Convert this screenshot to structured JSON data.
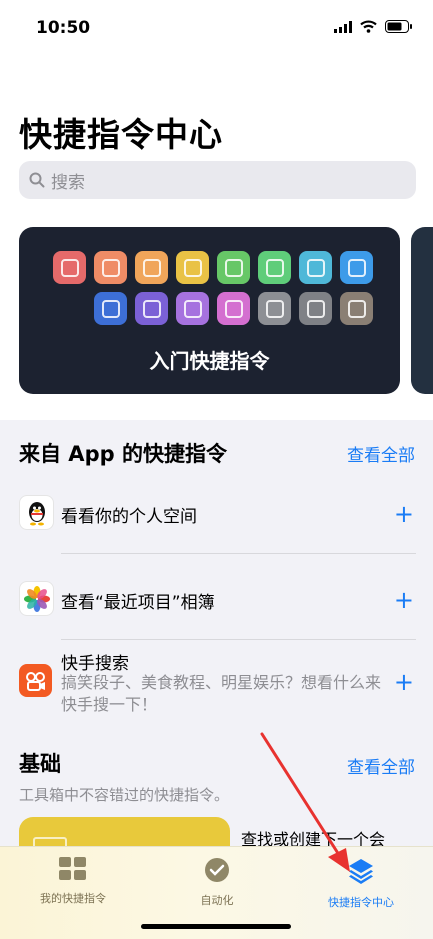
{
  "status": {
    "time": "10:50"
  },
  "header": {
    "title": "快捷指令中心",
    "search_placeholder": "搜索"
  },
  "hero": {
    "label": "入门快捷指令",
    "tiles": [
      {
        "icon": "calendar-add-icon",
        "color": "#e56a6a"
      },
      {
        "icon": "timer-icon",
        "color": "#ef8c66"
      },
      {
        "icon": "podcast-icon",
        "color": "#f0a55a"
      },
      {
        "icon": "reminder-icon",
        "color": "#e9c245"
      },
      {
        "icon": "message-add-icon",
        "color": "#67c767"
      },
      {
        "icon": "message-icon",
        "color": "#5fcd7a"
      },
      {
        "icon": "mail-icon",
        "color": "#4fb8d8"
      },
      {
        "icon": "send-icon",
        "color": "#3d9be9"
      },
      {
        "icon": "waveform-icon",
        "color": "#3d6fd6"
      },
      {
        "icon": "layers-icon",
        "color": "#7b61d6"
      },
      {
        "icon": "music-icon",
        "color": "#a672df"
      },
      {
        "icon": "photos-icon",
        "color": "#d46fd0"
      },
      {
        "icon": "qr-code-icon",
        "color": "#8d8f94"
      },
      {
        "icon": "share-arrow-icon",
        "color": "#7f8186"
      },
      {
        "icon": "camera-scan-icon",
        "color": "#8a7f74"
      }
    ]
  },
  "from_apps": {
    "title": "来自 App 的快捷指令",
    "see_all": "查看全部",
    "items": [
      {
        "title": "看看你的个人空间",
        "subtitle": ""
      },
      {
        "title": "查看“最近项目”相簿",
        "subtitle": ""
      },
      {
        "title": "快手搜索",
        "subtitle": "搞笑段子、美食教程、明星娱乐？想看什么来快手搜一下！"
      }
    ]
  },
  "basics": {
    "title": "基础",
    "see_all": "查看全部",
    "subtitle": "工具箱中不容错过的快捷指令。",
    "card_text": "查找或创建下一个会"
  },
  "tabbar": {
    "tabs": [
      {
        "label": "我的快捷指令"
      },
      {
        "label": "自动化"
      },
      {
        "label": "快捷指令中心"
      }
    ]
  },
  "colors": {
    "accent": "#1a7cf5",
    "annotation_arrow": "#e8322f"
  }
}
